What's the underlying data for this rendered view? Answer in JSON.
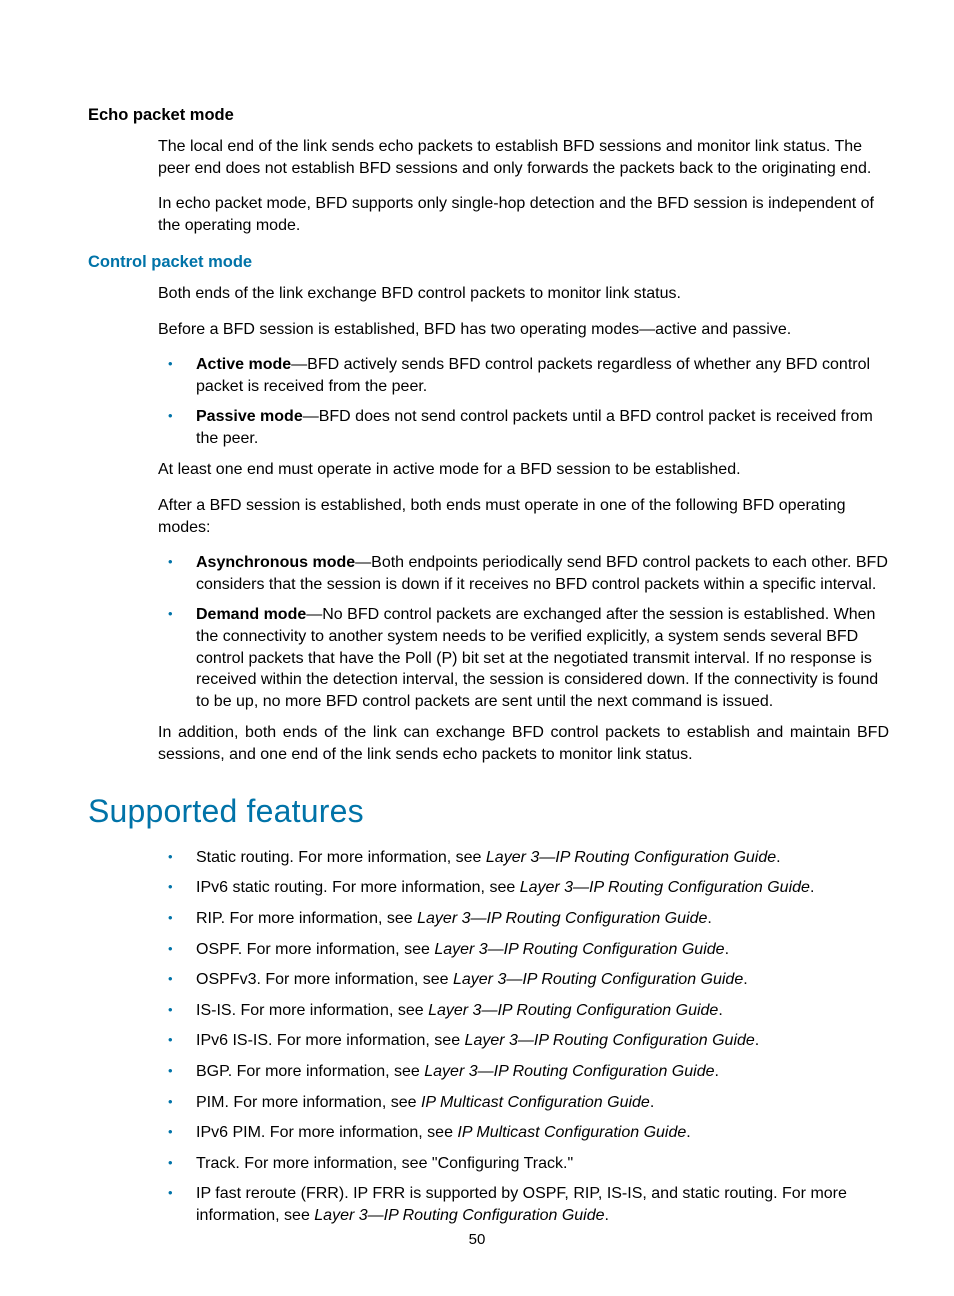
{
  "pageNumber": "50",
  "sections": {
    "echo": {
      "heading": "Echo packet mode",
      "p1": "The local end of the link sends echo packets to establish BFD sessions and monitor link status. The peer end does not establish BFD sessions and only forwards the packets back to the originating end.",
      "p2": "In echo packet mode, BFD supports only single-hop detection and the BFD session is independent of the operating mode."
    },
    "control": {
      "heading": "Control packet mode",
      "p1": "Both ends of the link exchange BFD control packets to monitor link status.",
      "p2": "Before a BFD session is established, BFD has two operating modes—active and passive.",
      "modes1": [
        {
          "term": "Active mode",
          "desc": "—BFD actively sends BFD control packets regardless of whether any BFD control packet is received from the peer."
        },
        {
          "term": "Passive mode",
          "desc": "—BFD does not send control packets until a BFD control packet is received from the peer."
        }
      ],
      "p3": "At least one end must operate in active mode for a BFD session to be established.",
      "p4": "After a BFD session is established, both ends must operate in one of the following BFD operating modes:",
      "modes2": [
        {
          "term": "Asynchronous mode",
          "desc": "—Both endpoints periodically send BFD control packets to each other. BFD considers that the session is down if it receives no BFD control packets within a specific interval."
        },
        {
          "term": "Demand mode",
          "desc": "—No BFD control packets are exchanged after the session is established. When the connectivity to another system needs to be verified explicitly, a system sends several BFD control packets that have the Poll (P) bit set at the negotiated transmit interval. If no response is received within the detection interval, the session is considered down. If the connectivity is found to be up, no more BFD control packets are sent until the next command is issued."
        }
      ],
      "p5": "In addition, both ends of the link can exchange BFD control packets to establish and maintain BFD sessions, and one end of the link sends echo packets to monitor link status."
    },
    "supported": {
      "heading": "Supported features",
      "items": [
        {
          "pre": "Static routing. For more information, see ",
          "ref": "Layer 3—IP Routing Configuration Guide",
          "post": "."
        },
        {
          "pre": "IPv6 static routing. For more information, see ",
          "ref": "Layer 3—IP Routing Configuration Guide",
          "post": "."
        },
        {
          "pre": "RIP. For more information, see ",
          "ref": "Layer 3—IP Routing Configuration Guide",
          "post": "."
        },
        {
          "pre": "OSPF. For more information, see ",
          "ref": "Layer 3—IP Routing Configuration Guide",
          "post": "."
        },
        {
          "pre": "OSPFv3. For more information, see ",
          "ref": "Layer 3—IP Routing Configuration Guide",
          "post": "."
        },
        {
          "pre": "IS-IS. For more information, see ",
          "ref": "Layer 3—IP Routing Configuration Guide",
          "post": "."
        },
        {
          "pre": "IPv6 IS-IS. For more information, see ",
          "ref": "Layer 3—IP Routing Configuration Guide",
          "post": "."
        },
        {
          "pre": "BGP. For more information, see ",
          "ref": "Layer 3—IP Routing Configuration Guide",
          "post": "."
        },
        {
          "pre": "PIM. For more information, see ",
          "ref": "IP Multicast Configuration Guide",
          "post": "."
        },
        {
          "pre": "IPv6 PIM. For more information, see ",
          "ref": "IP Multicast Configuration Guide",
          "post": "."
        },
        {
          "pre": "Track. For more information, see \"Configuring Track.\"",
          "ref": "",
          "post": ""
        },
        {
          "pre": "IP fast reroute (FRR). IP FRR is supported by OSPF, RIP, IS-IS, and static routing. For more information, see ",
          "ref": "Layer 3—IP Routing Configuration Guide",
          "post": "."
        }
      ]
    }
  }
}
